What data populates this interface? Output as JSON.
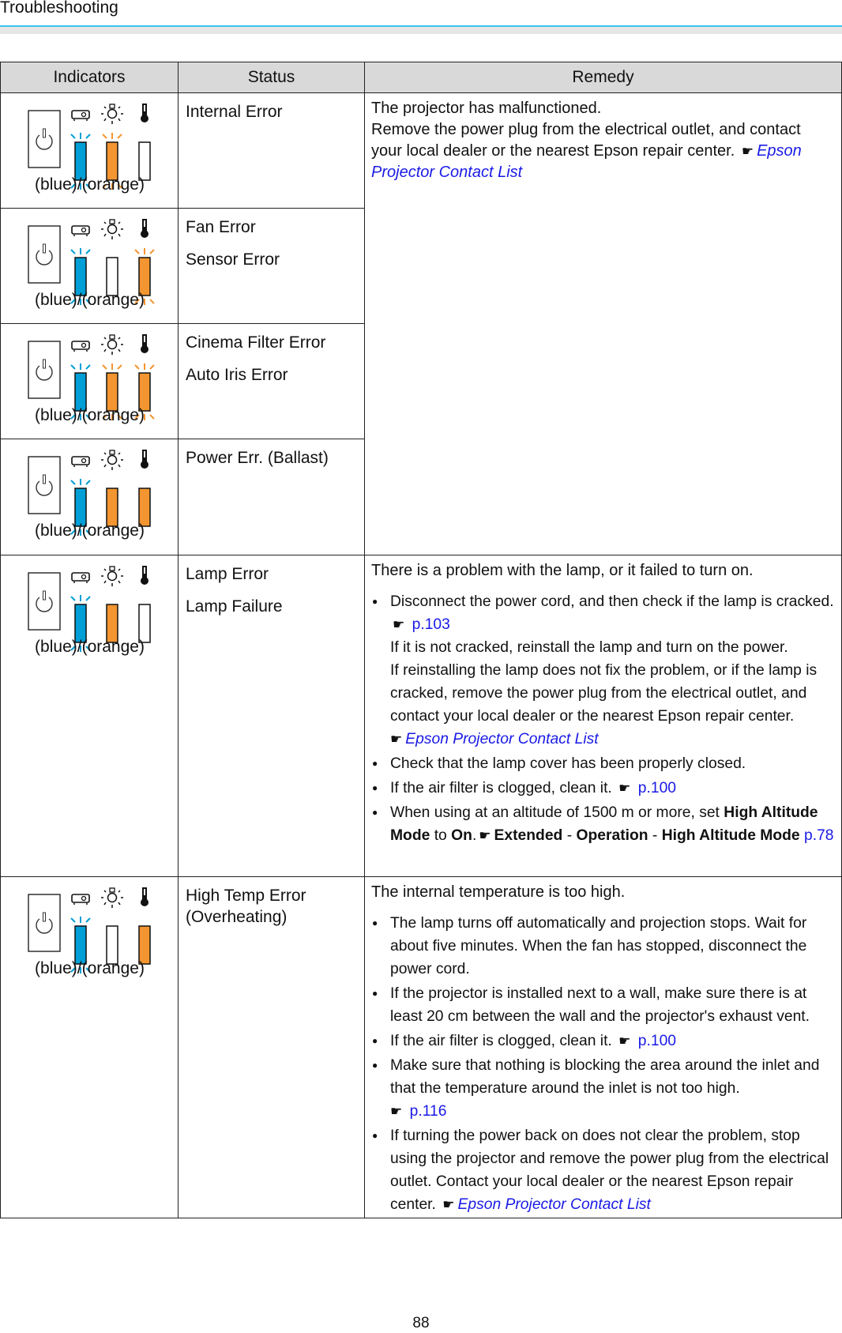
{
  "header": {
    "title": "Troubleshooting"
  },
  "table": {
    "columns": [
      "Indicators",
      "Status",
      "Remedy"
    ],
    "colors": {
      "blue": "#009fd6",
      "orange": "#f39530"
    },
    "caption": "(blue)/(orange)",
    "rows": [
      {
        "indicators": {
          "status": "flash-blue",
          "lamp": "flash-orange",
          "temp": "off"
        },
        "status": [
          "Internal Error"
        ]
      },
      {
        "indicators": {
          "status": "flash-blue",
          "lamp": "off",
          "temp": "flash-orange"
        },
        "status": [
          "Fan Error",
          "Sensor Error"
        ]
      },
      {
        "indicators": {
          "status": "flash-blue",
          "lamp": "flash-orange",
          "temp": "flash-orange"
        },
        "status": [
          "Cinema Filter Error",
          "Auto Iris Error"
        ]
      },
      {
        "indicators": {
          "status": "flash-blue",
          "lamp": "on-orange",
          "temp": "on-orange"
        },
        "status": [
          "Power Err. (Ballast)"
        ]
      },
      {
        "indicators": {
          "status": "flash-blue",
          "lamp": "on-orange",
          "temp": "off"
        },
        "status": [
          "Lamp Error",
          "Lamp Failure"
        ]
      },
      {
        "indicators": {
          "status": "flash-blue",
          "lamp": "off",
          "temp": "on-orange"
        },
        "status": [
          "High Temp Error (Overheating)"
        ]
      }
    ],
    "remedy_group1": {
      "line1": "The projector has malfunctioned.",
      "line2": "Remove the power plug from the electrical outlet, and contact your local dealer or the nearest Epson repair center.",
      "link": "Epson Projector Contact List"
    },
    "remedy_lamp": {
      "lead": "There is a problem with the lamp, or it failed to turn on.",
      "b1_text": "Disconnect the power cord, and then check if the lamp is cracked.",
      "b1_link": "p.103",
      "b1_cont1": "If it is not cracked, reinstall the lamp and turn on the power.",
      "b1_cont2": "If reinstalling the lamp does not fix the problem, or if the lamp is cracked, remove the power plug from the electrical outlet, and contact your local dealer or the nearest Epson repair center.",
      "b1_link2": "Epson Projector Contact List",
      "b2_text": "Check that the lamp cover has been properly closed.",
      "b3_text": "If the air filter is clogged, clean it.",
      "b3_link": "p.100",
      "b4_pre": "When using at an altitude of 1500 m or more, set",
      "b4_bold1": "High Altitude Mode",
      "b4_to": "to",
      "b4_bold2": "On",
      "b4_path1": "Extended",
      "b4_path2": "Operation",
      "b4_path3": "High Altitude Mode",
      "b4_link": "p.78"
    },
    "remedy_temp": {
      "lead": "The internal temperature is too high.",
      "b1_text": "The lamp turns off automatically and projection stops. Wait for about five minutes. When the fan has stopped, disconnect the power cord.",
      "b2_text": "If the projector is installed next to a wall, make sure there is at least 20 cm between the wall and the projector's exhaust vent.",
      "b3_text": "If the air filter is clogged, clean it.",
      "b3_link": "p.100",
      "b4_text": "Make sure that nothing is blocking the area around the inlet and that the temperature around the inlet is not too high.",
      "b4_link": "p.116",
      "b5_text": "If turning the power back on does not clear the problem, stop using the projector and remove the power plug from the electrical outlet. Contact your local dealer or the nearest Epson repair center.",
      "b5_link": "Epson Projector Contact List"
    }
  },
  "icons": {
    "reference": "pointing-hand-icon",
    "hand_glyph": "☛"
  },
  "footer": {
    "page_number": "88"
  }
}
